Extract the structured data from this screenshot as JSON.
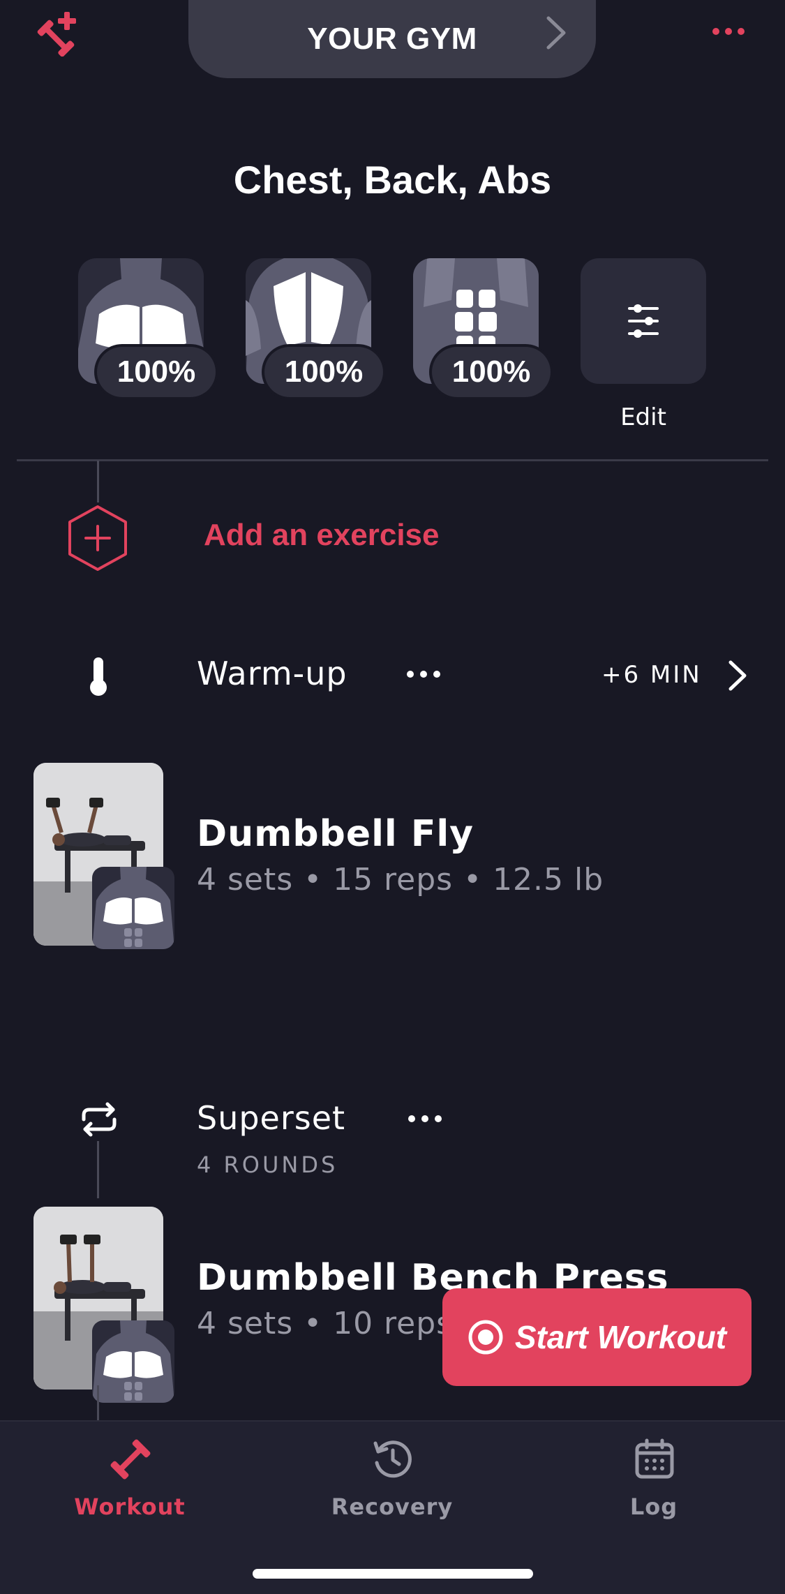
{
  "colors": {
    "accent": "#e2435e",
    "background": "#181824",
    "card": "#2b2b3a",
    "muted": "#9a9aa6"
  },
  "header": {
    "gym_name": "YOUR GYM",
    "left_icon": "add-dumbbell-icon",
    "right_icon": "more-dots-icon"
  },
  "workout": {
    "title": "Chest, Back, Abs",
    "muscles": [
      {
        "name": "chest",
        "percent": "100%"
      },
      {
        "name": "back",
        "percent": "100%"
      },
      {
        "name": "abs",
        "percent": "100%"
      }
    ],
    "edit_label": "Edit",
    "add_exercise_label": "Add an exercise",
    "warmup": {
      "label": "Warm-up",
      "duration": "+6 MIN"
    },
    "exercises": [
      {
        "name": "Dumbbell Fly",
        "meta": "4 sets • 15 reps • 12.5 lb"
      }
    ],
    "superset": {
      "label": "Superset",
      "rounds": "4 ROUNDS",
      "exercises": [
        {
          "name": "Dumbbell Bench Press",
          "meta": "4 sets • 10 reps"
        }
      ]
    }
  },
  "start_button": {
    "label": "Start Workout"
  },
  "bottom_nav": {
    "active": "Workout",
    "items": [
      {
        "label": "Workout",
        "icon": "dumbbell-icon"
      },
      {
        "label": "Recovery",
        "icon": "clock-refresh-icon"
      },
      {
        "label": "Log",
        "icon": "calendar-icon"
      }
    ]
  }
}
